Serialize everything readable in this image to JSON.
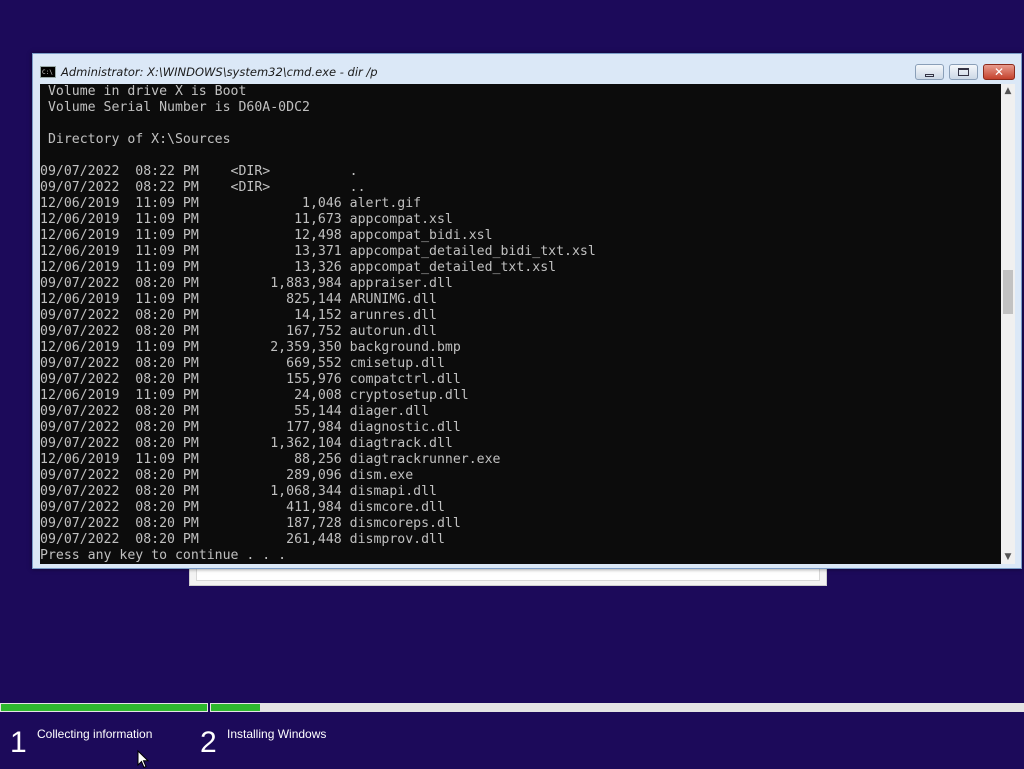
{
  "window": {
    "title": "Administrator: X:\\WINDOWS\\system32\\cmd.exe - dir /p",
    "icon_label": "C:\\",
    "close_label": "✕"
  },
  "console": {
    "lines": [
      " Volume in drive X is Boot",
      " Volume Serial Number is D60A-0DC2",
      "",
      " Directory of X:\\Sources",
      "",
      "09/07/2022  08:22 PM    <DIR>          .",
      "09/07/2022  08:22 PM    <DIR>          ..",
      "12/06/2019  11:09 PM             1,046 alert.gif",
      "12/06/2019  11:09 PM            11,673 appcompat.xsl",
      "12/06/2019  11:09 PM            12,498 appcompat_bidi.xsl",
      "12/06/2019  11:09 PM            13,371 appcompat_detailed_bidi_txt.xsl",
      "12/06/2019  11:09 PM            13,326 appcompat_detailed_txt.xsl",
      "09/07/2022  08:20 PM         1,883,984 appraiser.dll",
      "12/06/2019  11:09 PM           825,144 ARUNIMG.dll",
      "09/07/2022  08:20 PM            14,152 arunres.dll",
      "09/07/2022  08:20 PM           167,752 autorun.dll",
      "12/06/2019  11:09 PM         2,359,350 background.bmp",
      "09/07/2022  08:20 PM           669,552 cmisetup.dll",
      "09/07/2022  08:20 PM           155,976 compatctrl.dll",
      "12/06/2019  11:09 PM            24,008 cryptosetup.dll",
      "09/07/2022  08:20 PM            55,144 diager.dll",
      "09/07/2022  08:20 PM           177,984 diagnostic.dll",
      "09/07/2022  08:20 PM         1,362,104 diagtrack.dll",
      "12/06/2019  11:09 PM            88,256 diagtrackrunner.exe",
      "09/07/2022  08:20 PM           289,096 dism.exe",
      "09/07/2022  08:20 PM         1,068,344 dismapi.dll",
      "09/07/2022  08:20 PM           411,984 dismcore.dll",
      "09/07/2022  08:20 PM           187,728 dismcoreps.dll",
      "09/07/2022  08:20 PM           261,448 dismprov.dll",
      "Press any key to continue . . ."
    ]
  },
  "setup": {
    "steps": [
      {
        "number": "1",
        "label": "Collecting information"
      },
      {
        "number": "2",
        "label": "Installing Windows"
      }
    ],
    "progress": {
      "step1_fraction": 1.0,
      "step2_fraction": 0.06
    },
    "colors": {
      "background": "#1c0a5a",
      "progress_fill": "#2eb82e",
      "progress_track": "#e4e4e4"
    }
  }
}
